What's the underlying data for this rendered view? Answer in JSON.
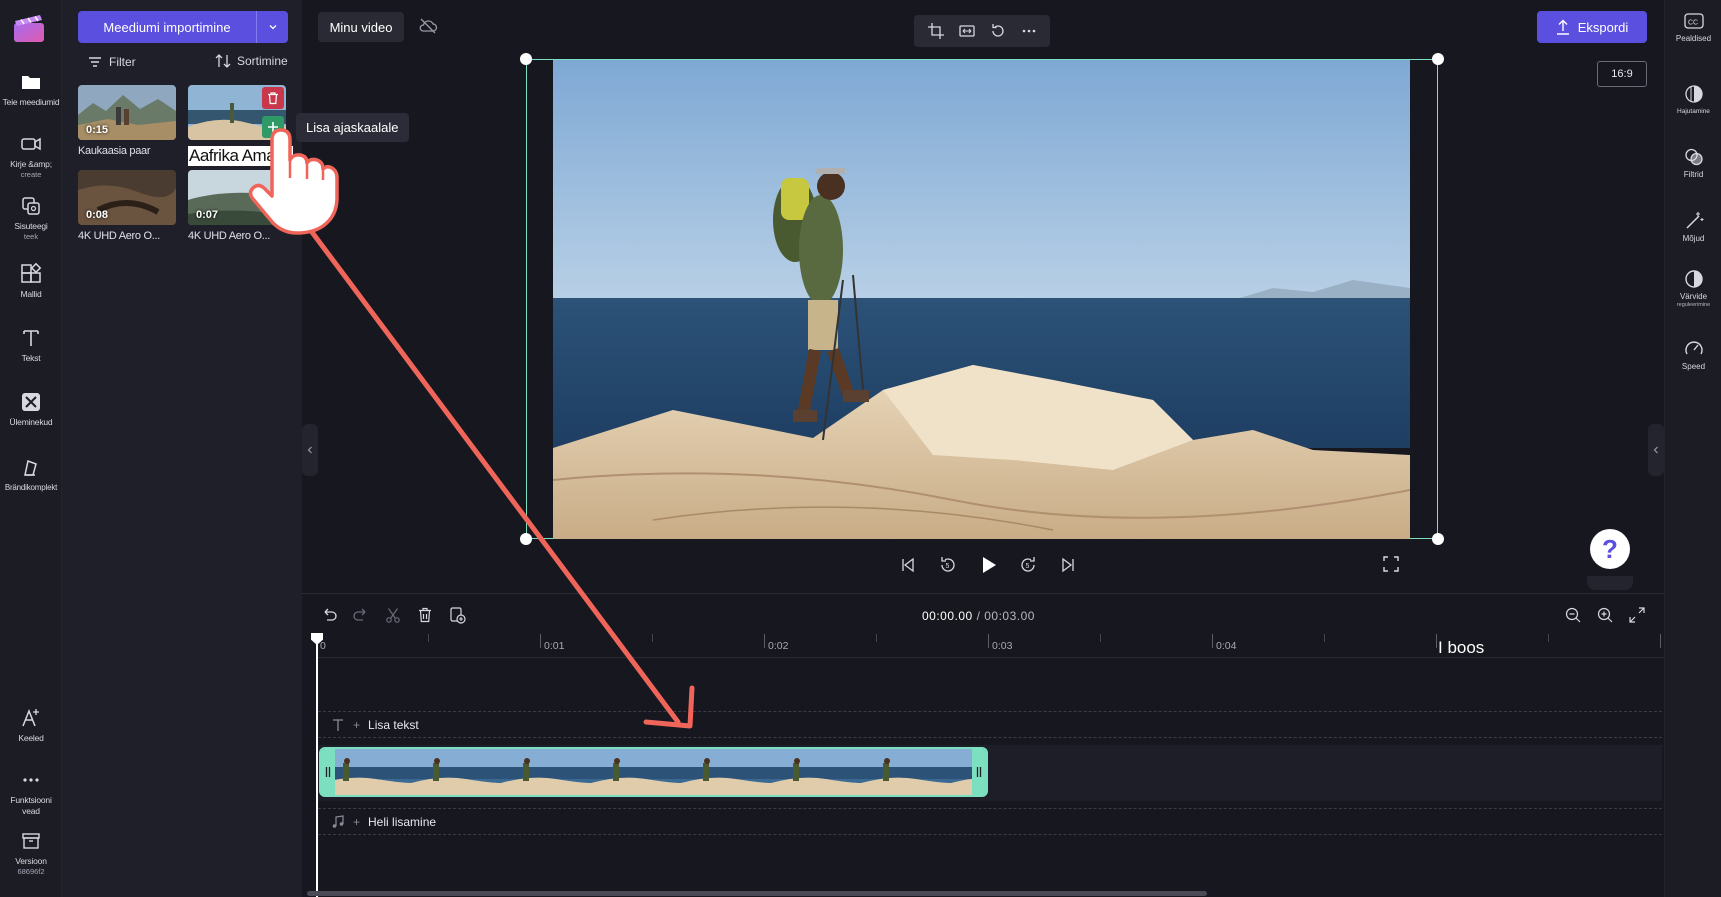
{
  "left_rail": {
    "items": [
      {
        "label": "Teie meediumid",
        "icon": "folder-icon"
      },
      {
        "label": "Kirje &amp;",
        "sub": "create",
        "icon": "camera-icon"
      },
      {
        "label": "Sisuteegi",
        "sub": "teek",
        "icon": "library-icon"
      },
      {
        "label": "Mallid",
        "icon": "templates-icon"
      },
      {
        "label": "Tekst",
        "icon": "text-icon"
      },
      {
        "label": "Üleminekud",
        "icon": "transitions-icon"
      },
      {
        "label": "Brändikomplekt",
        "icon": "brand-kit-icon"
      }
    ],
    "bottom_items": [
      {
        "label": "Keeled",
        "icon": "language-icon"
      },
      {
        "label": "Funktsiooni",
        "sub": "vead",
        "icon": "more-icon"
      },
      {
        "label": "Versioon",
        "sub": "68696f2",
        "icon": "archive-icon"
      }
    ]
  },
  "media_panel": {
    "import_label": "Meediumi importimine",
    "filter_label": "Filter",
    "sort_label": "Sortimine",
    "items": [
      {
        "duration": "0:15",
        "label": "Kaukaasia paar"
      },
      {
        "duration": "",
        "label": "Aafrika Amari I"
      },
      {
        "duration": "0:08",
        "label": "4K UHD Aero O..."
      },
      {
        "duration": "0:07",
        "label": "4K UHD Aero O..."
      }
    ],
    "tooltip": "Lisa ajaskaalale"
  },
  "topbar": {
    "title": "Minu video",
    "export_label": "Ekspordi",
    "aspect_ratio": "16:9"
  },
  "right_rail": {
    "items": [
      {
        "label": "Pealdised",
        "icon": "captions-icon"
      },
      {
        "label": "Hajutamine",
        "icon": "fade-icon"
      },
      {
        "label": "Filtrid",
        "icon": "filters-icon"
      },
      {
        "label": "Mõjud",
        "icon": "effects-icon"
      },
      {
        "label": "Värvide",
        "sub": "reguleerimine",
        "icon": "color-adjust-icon"
      },
      {
        "label": "Speed",
        "icon": "speed-icon"
      }
    ]
  },
  "player": {
    "help": "?"
  },
  "timeline": {
    "current_time": "00:00.00",
    "total_time": "/ 00:03.00",
    "ticks": [
      "0",
      "0:01",
      "0:02",
      "0:03",
      "0:04"
    ],
    "add_text_label": "Lisa tekst",
    "add_audio_label": "Heli lisamine",
    "floating_text": "I boos"
  },
  "colors": {
    "accent": "#5b4fe0",
    "clip_border": "#7ce0c0",
    "delete": "#c8384a",
    "add": "#2f9a68",
    "annotation": "#f0655a"
  }
}
